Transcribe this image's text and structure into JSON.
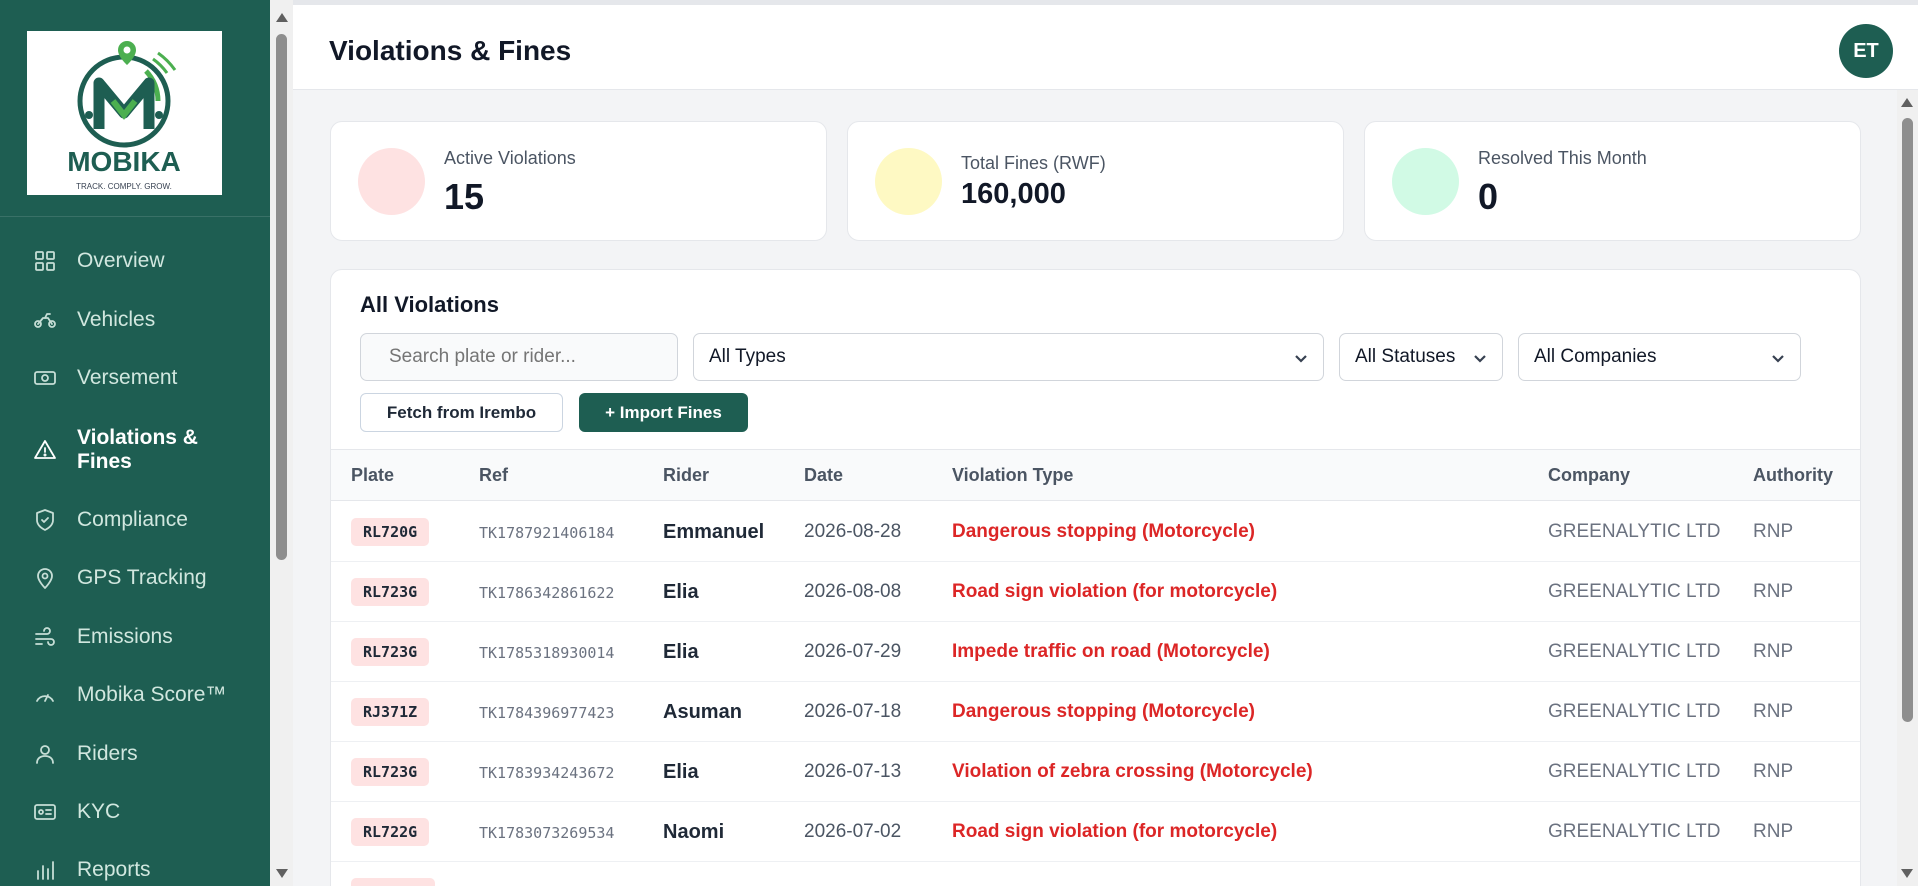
{
  "app": {
    "logo_text": "MOBIKA",
    "logo_tagline": "TRACK. COMPLY. GROW."
  },
  "sidebar": {
    "items": [
      {
        "label": "Overview",
        "icon": "grid-icon"
      },
      {
        "label": "Vehicles",
        "icon": "motorcycle-icon"
      },
      {
        "label": "Versement",
        "icon": "cash-icon"
      },
      {
        "label": "Violations & Fines",
        "icon": "warning-triangle-icon",
        "active": true
      },
      {
        "label": "Compliance",
        "icon": "shield-check-icon"
      },
      {
        "label": "GPS Tracking",
        "icon": "map-pin-icon"
      },
      {
        "label": "Emissions",
        "icon": "wind-icon"
      },
      {
        "label": "Mobika Score™",
        "icon": "gauge-icon"
      },
      {
        "label": "Riders",
        "icon": "user-icon"
      },
      {
        "label": "KYC",
        "icon": "id-card-icon"
      },
      {
        "label": "Reports",
        "icon": "bar-chart-icon"
      }
    ]
  },
  "header": {
    "title": "Violations & Fines",
    "avatar_initials": "ET"
  },
  "stats": [
    {
      "label": "Active Violations",
      "value": "15",
      "color": "#fee2e2"
    },
    {
      "label": "Total Fines (RWF)",
      "value": "160,000",
      "color": "#fef9c3"
    },
    {
      "label": "Resolved This Month",
      "value": "0",
      "color": "#d1fae5"
    }
  ],
  "violations": {
    "title": "All Violations",
    "search_placeholder": "Search plate or rider...",
    "type_filter": "All Types",
    "status_filter": "All Statuses",
    "company_filter": "All Companies",
    "fetch_button": "Fetch from Irembo",
    "import_button": "+ Import Fines",
    "columns": [
      "Plate",
      "Ref",
      "Rider",
      "Date",
      "Violation Type",
      "Company",
      "Authority"
    ],
    "rows": [
      {
        "plate": "RL720G",
        "ref": "TK1787921406184",
        "rider": "Emmanuel",
        "date": "2026-08-28",
        "type": "Dangerous stopping (Motorcycle)",
        "company": "GREENALYTIC LTD",
        "authority": "RNP"
      },
      {
        "plate": "RL723G",
        "ref": "TK1786342861622",
        "rider": "Elia",
        "date": "2026-08-08",
        "type": "Road sign violation (for motorcycle)",
        "company": "GREENALYTIC LTD",
        "authority": "RNP"
      },
      {
        "plate": "RL723G",
        "ref": "TK1785318930014",
        "rider": "Elia",
        "date": "2026-07-29",
        "type": "Impede traffic on road (Motorcycle)",
        "company": "GREENALYTIC LTD",
        "authority": "RNP"
      },
      {
        "plate": "RJ371Z",
        "ref": "TK1784396977423",
        "rider": "Asuman",
        "date": "2026-07-18",
        "type": "Dangerous stopping (Motorcycle)",
        "company": "GREENALYTIC LTD",
        "authority": "RNP"
      },
      {
        "plate": "RL723G",
        "ref": "TK1783934243672",
        "rider": "Elia",
        "date": "2026-07-13",
        "type": "Violation of zebra crossing (Motorcycle)",
        "company": "GREENALYTIC LTD",
        "authority": "RNP"
      },
      {
        "plate": "RL722G",
        "ref": "TK1783073269534",
        "rider": "Naomi",
        "date": "2026-07-02",
        "type": "Road sign violation (for motorcycle)",
        "company": "GREENALYTIC LTD",
        "authority": "RNP"
      }
    ]
  }
}
